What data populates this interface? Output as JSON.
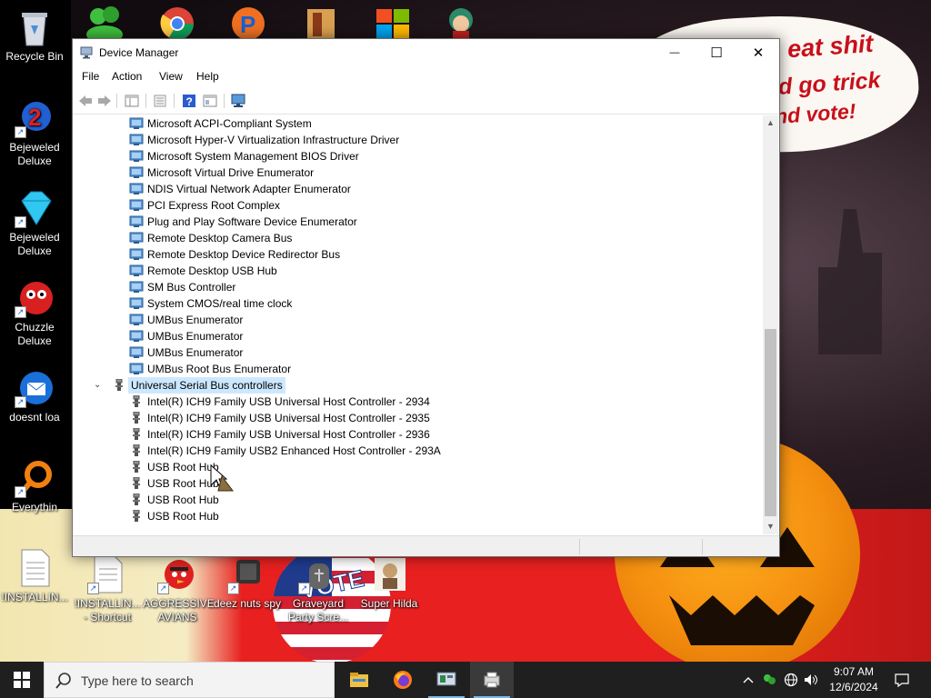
{
  "window": {
    "title": "Device Manager",
    "controls": {
      "minimize": "—",
      "maximize": "☐",
      "close": "✕"
    }
  },
  "menu": [
    {
      "label": "File"
    },
    {
      "label": "Action"
    },
    {
      "label": "View"
    },
    {
      "label": "Help"
    }
  ],
  "toolbar": {
    "buttons": [
      "back-icon",
      "forward-icon",
      "properties-view-icon",
      "list-view-icon",
      "help-icon",
      "device-view-icon",
      "monitor-icon"
    ]
  },
  "tree": {
    "system_devices": [
      "Microsoft ACPI-Compliant System",
      "Microsoft Hyper-V Virtualization Infrastructure Driver",
      "Microsoft System Management BIOS Driver",
      "Microsoft Virtual Drive Enumerator",
      "NDIS Virtual Network Adapter Enumerator",
      "PCI Express Root Complex",
      "Plug and Play Software Device Enumerator",
      "Remote Desktop Camera Bus",
      "Remote Desktop Device Redirector Bus",
      "Remote Desktop USB Hub",
      "SM Bus Controller",
      "System CMOS/real time clock",
      "UMBus Enumerator",
      "UMBus Enumerator",
      "UMBus Enumerator",
      "UMBus Root Bus Enumerator"
    ],
    "usb_category": "Universal Serial Bus controllers",
    "usb_devices": [
      "Intel(R) ICH9 Family USB Universal Host Controller - 2934",
      "Intel(R) ICH9 Family USB Universal Host Controller - 2935",
      "Intel(R) ICH9 Family USB Universal Host Controller - 2936",
      "Intel(R) ICH9 Family USB2 Enhanced Host Controller - 293A",
      "USB Root Hub",
      "USB Root Hub",
      "USB Root Hub",
      "USB Root Hub"
    ]
  },
  "desktop": {
    "left_icons": [
      {
        "label": "Recycle Bin",
        "icon": "recycle-bin-icon"
      },
      {
        "label": "Bejeweled Deluxe",
        "icon": "bejeweled-icon"
      },
      {
        "label": "Bejeweled Deluxe",
        "icon": "diamond-icon"
      },
      {
        "label": "Chuzzle Deluxe",
        "icon": "chuzzle-icon"
      },
      {
        "label": "doesnt loa",
        "icon": "thunderbird-icon"
      },
      {
        "label": "Everythin",
        "icon": "everything-search-icon"
      },
      {
        "label": "!INSTALLIN...",
        "icon": "text-file-icon"
      }
    ],
    "bottom_icons": [
      {
        "label": "!INSTALLIN... - Shortcut",
        "icon": "text-file-icon"
      },
      {
        "label": "AGGRESSIVE AVIANS",
        "icon": "angry-bird-icon"
      },
      {
        "label": "deez nuts spy",
        "icon": "app-icon"
      },
      {
        "label": "Graveyard Party Scre...",
        "icon": "graveyard-icon"
      },
      {
        "label": "Super Hilda",
        "icon": "super-hilda-icon"
      }
    ],
    "wallpaper_text": [
      "eat shit",
      "d go trick",
      "nd vote!"
    ],
    "wallpaper_badge": "VOTE"
  },
  "taskbar": {
    "search_placeholder": "Type here to search",
    "apps": [
      "file-explorer-icon",
      "firefox-icon",
      "device-manager-taskbar-icon",
      "printer-app-icon"
    ],
    "time": "9:07 AM",
    "date": "12/6/2024"
  },
  "colors": {
    "selection": "#cce8ff",
    "taskbar": "#1f1f1f",
    "wallpaper_red": "#e82020",
    "accent": "#76b9ed"
  }
}
